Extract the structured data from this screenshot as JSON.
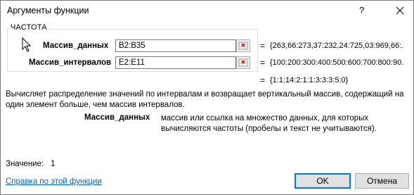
{
  "dialog": {
    "title": "Аргументы функции",
    "help_button": "?",
    "close_icon": "close-icon"
  },
  "function_group": {
    "name": "ЧАСТОТА",
    "args": [
      {
        "label": "Массив_данных",
        "value": "B2:B35",
        "evaluated": "{263,66:273,37:232,24:725,03:969,66:..."
      },
      {
        "label": "Массив_интервалов",
        "value": "E2:E11",
        "evaluated": "{100:200:300:400:500:600:700:800:90..."
      }
    ],
    "ref_icon": "range-select-icon"
  },
  "result_preview": "{1:1:14:2:1:1:3:3:3:5:0}",
  "equals_sign": "=",
  "description": "Вычисляет распределение значений по интервалам и возвращает вертикальный массив, содержащий на один элемент больше, чем массив интервалов.",
  "argument_help": {
    "name": "Массив_данных",
    "text": "массив или ссылка на множество данных, для которых вычисляются частоты (пробелы и текст не учитываются)."
  },
  "value": {
    "label": "Значение:",
    "result": "1"
  },
  "help_link": "Справка по этой функции",
  "buttons": {
    "ok": "OK",
    "cancel": "Отмена"
  }
}
